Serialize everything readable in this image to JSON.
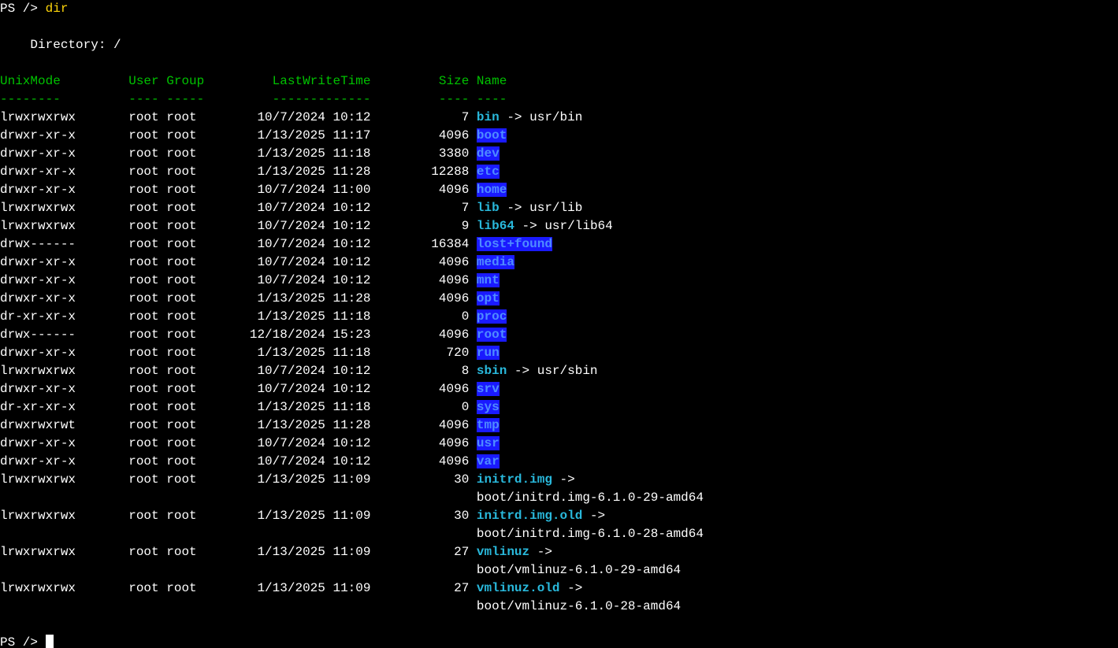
{
  "prompt_prefix": "PS /> ",
  "command": "dir",
  "blank": "",
  "directory_line": "    Directory: /",
  "header": {
    "unixmode": "UnixMode",
    "user": "User",
    "group": "Group",
    "lwt": "LastWriteTime",
    "size": "Size",
    "name": "Name"
  },
  "dashes": {
    "unixmode": "--------",
    "user": "----",
    "group": "-----",
    "lwt": "-------------",
    "size": "----",
    "name": "----"
  },
  "rows": [
    {
      "mode": "lrwxrwxrwx",
      "user": "root",
      "group": "root",
      "lwt": "10/7/2024 10:12",
      "size": "7",
      "name": "bin",
      "link_suffix": " -> usr/bin",
      "style": "cyan-bold"
    },
    {
      "mode": "drwxr-xr-x",
      "user": "root",
      "group": "root",
      "lwt": "1/13/2025 11:17",
      "size": "4096",
      "name": "boot",
      "style": "blue-onblue"
    },
    {
      "mode": "drwxr-xr-x",
      "user": "root",
      "group": "root",
      "lwt": "1/13/2025 11:18",
      "size": "3380",
      "name": "dev",
      "style": "blue-onblue"
    },
    {
      "mode": "drwxr-xr-x",
      "user": "root",
      "group": "root",
      "lwt": "1/13/2025 11:28",
      "size": "12288",
      "name": "etc",
      "style": "blue-onblue"
    },
    {
      "mode": "drwxr-xr-x",
      "user": "root",
      "group": "root",
      "lwt": "10/7/2024 11:00",
      "size": "4096",
      "name": "home",
      "style": "blue-onblue"
    },
    {
      "mode": "lrwxrwxrwx",
      "user": "root",
      "group": "root",
      "lwt": "10/7/2024 10:12",
      "size": "7",
      "name": "lib",
      "link_suffix": " -> usr/lib",
      "style": "cyan-bold"
    },
    {
      "mode": "lrwxrwxrwx",
      "user": "root",
      "group": "root",
      "lwt": "10/7/2024 10:12",
      "size": "9",
      "name": "lib64",
      "link_suffix": " -> usr/lib64",
      "style": "cyan-bold"
    },
    {
      "mode": "drwx------",
      "user": "root",
      "group": "root",
      "lwt": "10/7/2024 10:12",
      "size": "16384",
      "name": "lost+found",
      "style": "blue-onblue"
    },
    {
      "mode": "drwxr-xr-x",
      "user": "root",
      "group": "root",
      "lwt": "10/7/2024 10:12",
      "size": "4096",
      "name": "media",
      "style": "blue-onblue"
    },
    {
      "mode": "drwxr-xr-x",
      "user": "root",
      "group": "root",
      "lwt": "10/7/2024 10:12",
      "size": "4096",
      "name": "mnt",
      "style": "blue-onblue"
    },
    {
      "mode": "drwxr-xr-x",
      "user": "root",
      "group": "root",
      "lwt": "1/13/2025 11:28",
      "size": "4096",
      "name": "opt",
      "style": "blue-onblue"
    },
    {
      "mode": "dr-xr-xr-x",
      "user": "root",
      "group": "root",
      "lwt": "1/13/2025 11:18",
      "size": "0",
      "name": "proc",
      "style": "blue-onblue"
    },
    {
      "mode": "drwx------",
      "user": "root",
      "group": "root",
      "lwt": "12/18/2024 15:23",
      "size": "4096",
      "name": "root",
      "style": "blue-onblue"
    },
    {
      "mode": "drwxr-xr-x",
      "user": "root",
      "group": "root",
      "lwt": "1/13/2025 11:18",
      "size": "720",
      "name": "run",
      "style": "blue-onblue"
    },
    {
      "mode": "lrwxrwxrwx",
      "user": "root",
      "group": "root",
      "lwt": "10/7/2024 10:12",
      "size": "8",
      "name": "sbin",
      "link_suffix": " -> usr/sbin",
      "style": "cyan-bold"
    },
    {
      "mode": "drwxr-xr-x",
      "user": "root",
      "group": "root",
      "lwt": "10/7/2024 10:12",
      "size": "4096",
      "name": "srv",
      "style": "blue-onblue"
    },
    {
      "mode": "dr-xr-xr-x",
      "user": "root",
      "group": "root",
      "lwt": "1/13/2025 11:18",
      "size": "0",
      "name": "sys",
      "style": "blue-onblue"
    },
    {
      "mode": "drwxrwxrwt",
      "user": "root",
      "group": "root",
      "lwt": "1/13/2025 11:28",
      "size": "4096",
      "name": "tmp",
      "style": "blue-onblue"
    },
    {
      "mode": "drwxr-xr-x",
      "user": "root",
      "group": "root",
      "lwt": "10/7/2024 10:12",
      "size": "4096",
      "name": "usr",
      "style": "blue-onblue"
    },
    {
      "mode": "drwxr-xr-x",
      "user": "root",
      "group": "root",
      "lwt": "10/7/2024 10:12",
      "size": "4096",
      "name": "var",
      "style": "blue-onblue"
    },
    {
      "mode": "lrwxrwxrwx",
      "user": "root",
      "group": "root",
      "lwt": "1/13/2025 11:09",
      "size": "30",
      "name": "initrd.img",
      "link_suffix": " ->",
      "style": "cyan-bold",
      "wrap": "boot/initrd.img-6.1.0-29-amd64"
    },
    {
      "mode": "lrwxrwxrwx",
      "user": "root",
      "group": "root",
      "lwt": "1/13/2025 11:09",
      "size": "30",
      "name": "initrd.img.old",
      "link_suffix": " ->",
      "style": "cyan-bold",
      "wrap": "boot/initrd.img-6.1.0-28-amd64"
    },
    {
      "mode": "lrwxrwxrwx",
      "user": "root",
      "group": "root",
      "lwt": "1/13/2025 11:09",
      "size": "27",
      "name": "vmlinuz",
      "link_suffix": " ->",
      "style": "cyan-bold",
      "wrap": "boot/vmlinuz-6.1.0-29-amd64"
    },
    {
      "mode": "lrwxrwxrwx",
      "user": "root",
      "group": "root",
      "lwt": "1/13/2025 11:09",
      "size": "27",
      "name": "vmlinuz.old",
      "link_suffix": " ->",
      "style": "cyan-bold",
      "wrap": "boot/vmlinuz-6.1.0-28-amd64"
    }
  ],
  "widths": {
    "mode": 17,
    "user": 5,
    "group": 6,
    "lwt": 21,
    "size": 13,
    "name_indent": 63
  },
  "prompt2": "PS /> "
}
